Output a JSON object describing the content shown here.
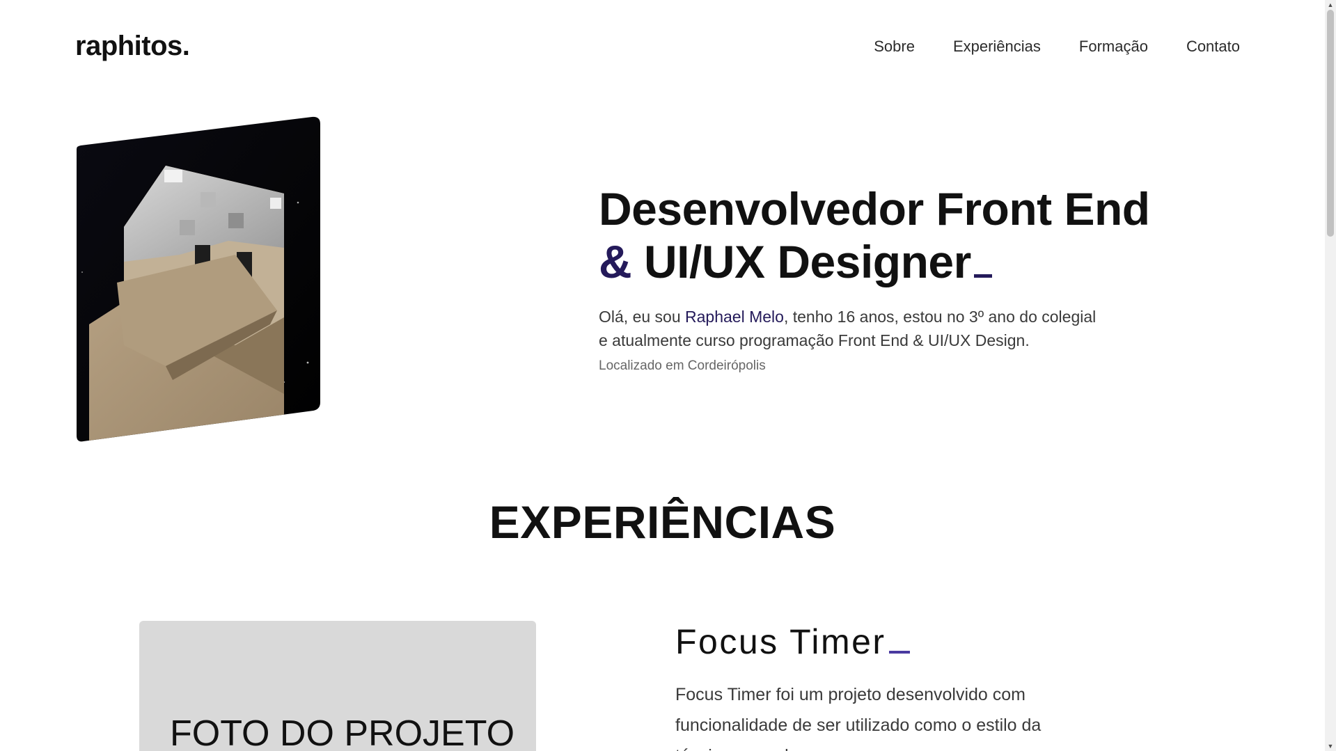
{
  "header": {
    "logo": "raphitos.",
    "nav": [
      "Sobre",
      "Experiências",
      "Formação",
      "Contato"
    ]
  },
  "hero": {
    "title_line1": "Desenvolvedor Front End",
    "title_amp": "&",
    "title_line2": "UI/UX Designer",
    "intro_before": "Olá, eu sou ",
    "intro_name": "Raphael Melo",
    "intro_after": ", tenho 16 anos, estou no 3º ano do colegial e atualmente curso programação Front End & UI/UX Design.",
    "location": "Localizado em Cordeirópolis"
  },
  "experiences": {
    "section_title": "EXPERIÊNCIAS",
    "project": {
      "photo_placeholder": "FOTO DO PROJETO",
      "title": "Focus Timer",
      "description": "Focus Timer foi um projeto desenvolvido com funcionalidade de ser utilizado como o estilo da técnica pomodoro."
    }
  },
  "colors": {
    "accent": "#241a5a",
    "text": "#111111",
    "muted": "#666666",
    "photo_bg": "#d9d9d9"
  },
  "icons": {
    "scroll_up": "chevron-up-icon",
    "scroll_down": "chevron-down-icon"
  }
}
